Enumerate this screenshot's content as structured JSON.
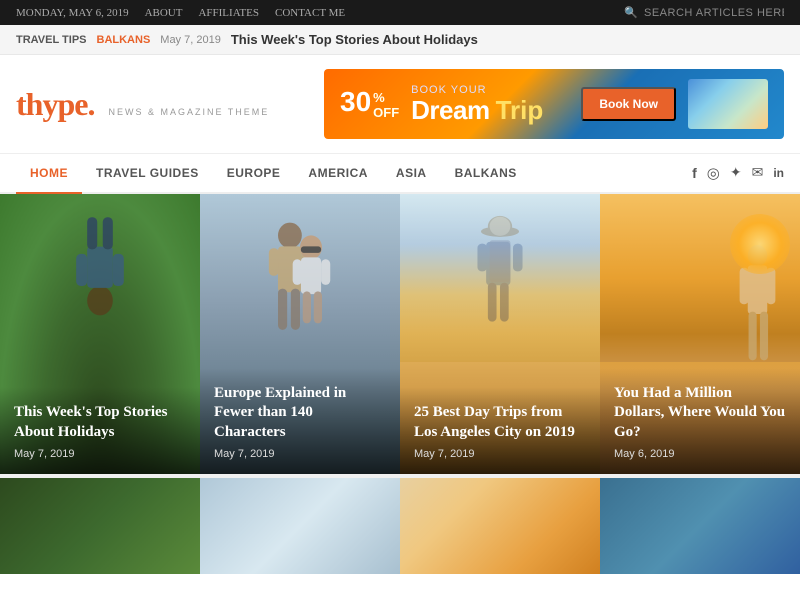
{
  "topbar": {
    "date": "MONDAY, MAY 6, 2019",
    "about": "ABOUT",
    "affiliates": "AFFILIATES",
    "contact": "CONTACT ME",
    "search_placeholder": "SEARCH ARTICLES HERE..."
  },
  "ticker": {
    "tag": "TRAVEL TIPS",
    "tag_orange": "BALKANS",
    "date": "May 7, 2019",
    "title": "This Week's Top Stories About Holidays"
  },
  "header": {
    "logo": "thype.",
    "tagline": "NEWS & MAGAZINE THEME"
  },
  "ad": {
    "discount": "30",
    "off": "OFF",
    "book": "Book Your",
    "dream": "Dream",
    "trip": "Trip",
    "cta": "Book Now"
  },
  "nav": {
    "items": [
      {
        "label": "HOME",
        "active": true
      },
      {
        "label": "TRAVEL GUIDES",
        "active": false
      },
      {
        "label": "EUROPE",
        "active": false
      },
      {
        "label": "AMERICA",
        "active": false
      },
      {
        "label": "ASIA",
        "active": false
      },
      {
        "label": "BALKANS",
        "active": false
      }
    ],
    "social": [
      "f",
      "◎",
      "✦",
      "✉",
      "in"
    ]
  },
  "cards": [
    {
      "title": "This Week's Top Stories About Holidays",
      "date": "May 7, 2019"
    },
    {
      "title": "Europe Explained in Fewer than 140 Characters",
      "date": "May 7, 2019"
    },
    {
      "title": "25 Best Day Trips from Los Angeles City on 2019",
      "date": "May 7, 2019"
    },
    {
      "title": "You Had a Million Dollars, Where Would You Go?",
      "date": "May 6, 2019"
    }
  ]
}
